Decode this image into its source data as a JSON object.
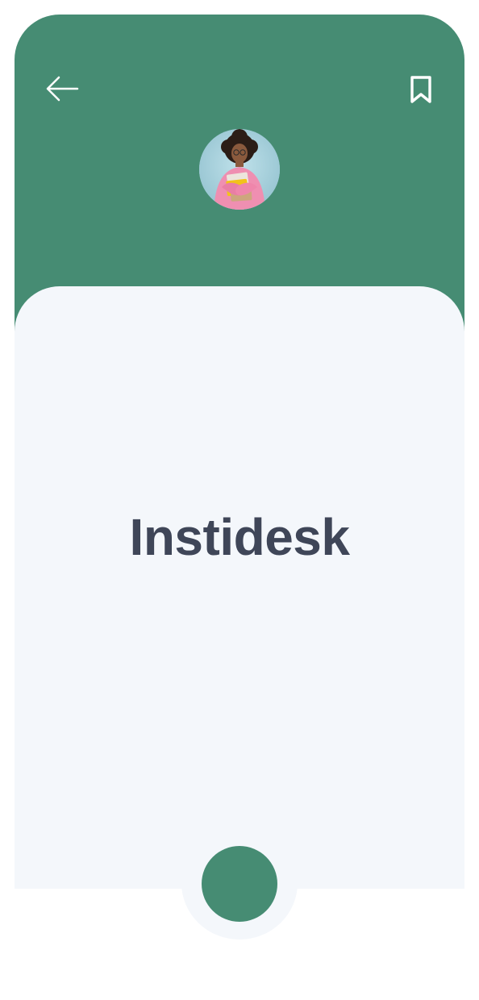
{
  "app": {
    "title": "Instidesk"
  },
  "header": {
    "back_icon": "arrow-left-icon",
    "bookmark_icon": "bookmark-icon"
  },
  "profile": {
    "avatar": "student-avatar"
  },
  "fab": {
    "icon": "circle-action"
  },
  "colors": {
    "brand": "#468c73",
    "card": "#f4f7fb",
    "title": "#3f4658"
  }
}
